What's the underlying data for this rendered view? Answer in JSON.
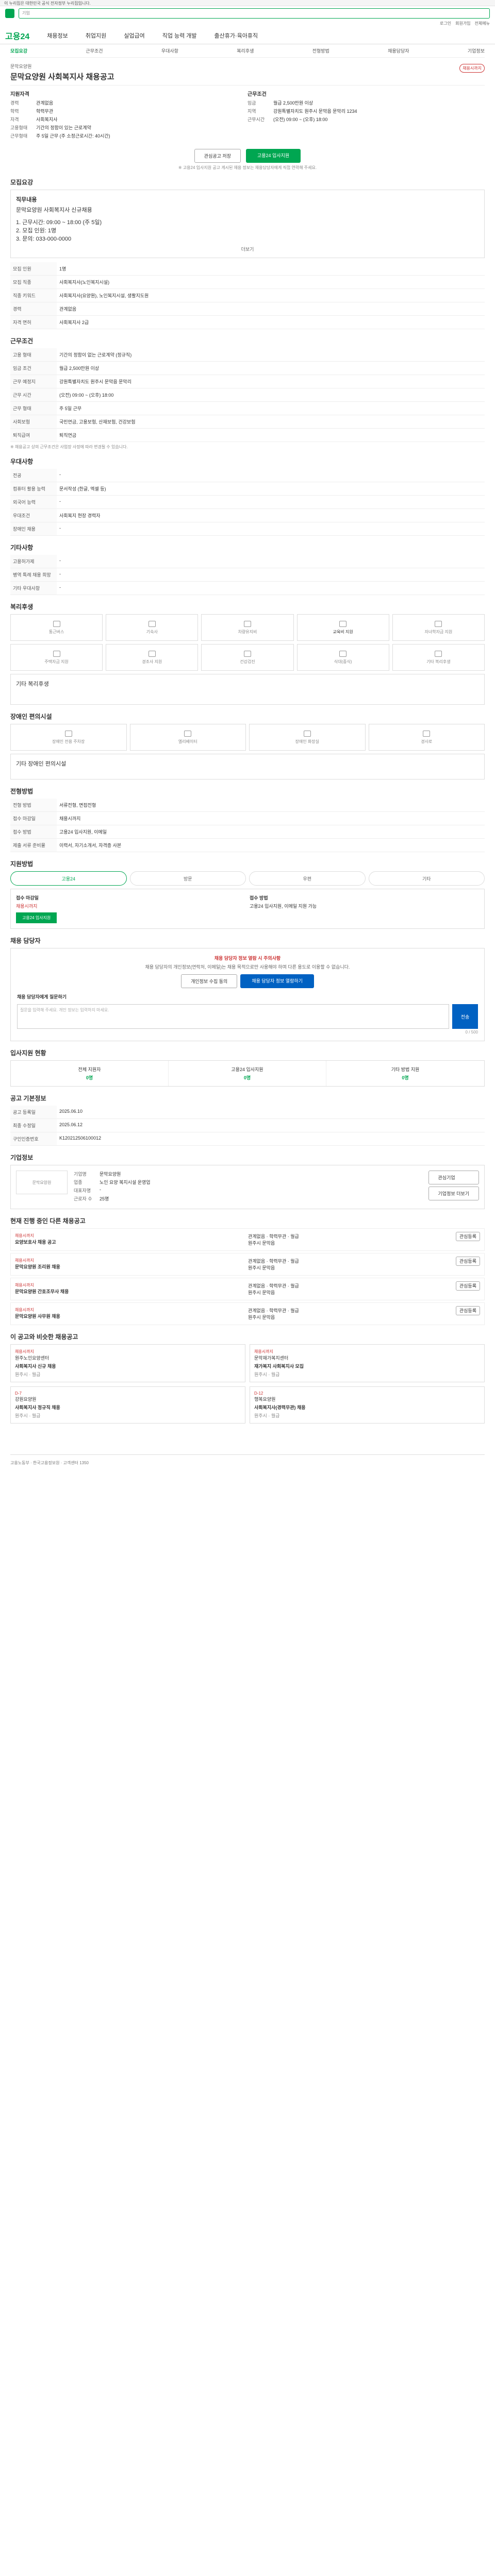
{
  "gov_banner": "이 누리집은 대한민국 공식 전자정부 누리집입니다.",
  "header": {
    "search_placeholder": "기업",
    "top_links": [
      "로그인",
      "회원가입",
      "전체메뉴"
    ],
    "brand": "고용24",
    "menus": [
      "채용정보",
      "취업지원",
      "실업급여",
      "직업 능력 개발",
      "출산휴가·육아휴직"
    ]
  },
  "detail_tabs": [
    "모집요강",
    "근무조건",
    "우대사항",
    "복리후생",
    "전형방법",
    "채용담당자",
    "기업정보"
  ],
  "job": {
    "company": "문막요양원",
    "title": "문막요양원 사회복지사 채용공고",
    "badge": "채용시까지",
    "summary_left": {
      "heading": "지원자격",
      "rows": [
        {
          "k": "경력",
          "v": "관계없음"
        },
        {
          "k": "학력",
          "v": "학력무관"
        },
        {
          "k": "자격",
          "v": "사회복지사"
        },
        {
          "k": "고용형태",
          "v": "기간의 정함이 있는 근로계약"
        },
        {
          "k": "근무형태",
          "v": "주 5일 근무 (주 소정근로시간: 40시간)"
        }
      ]
    },
    "summary_right": {
      "heading": "근무조건",
      "rows": [
        {
          "k": "임금",
          "v": "월급 2,500만원 이상"
        },
        {
          "k": "지역",
          "v": "강원특별자치도 원주시 문막읍 문막리 1234"
        },
        {
          "k": "근무시간",
          "v": "(오전) 09:00 ~ (오후) 18:00"
        }
      ]
    },
    "save_btn": "관심공고 저장",
    "apply_btn": "고용24 입사지원",
    "notice": "※ 고용24 입사지원 공고 게시된 채용 정보는 채용담당자에게 직접 연락해 주세요."
  },
  "recruit": {
    "heading": "모집요강",
    "duties_title": "직무내용",
    "duties": [
      "문막요양원 사회복지사 신규채용",
      "1. 근무시간: 09:00 ~ 18:00 (주 5일)",
      "2. 모집 인원: 1명",
      "3. 문의: 033-000-0000"
    ],
    "more": "더보기",
    "rows": [
      {
        "k": "모집 인원",
        "v": "1명"
      },
      {
        "k": "모집 직종",
        "v": "사회복지사(노인복지시설)"
      },
      {
        "k": "직종 키워드",
        "v": "사회복지사(요양원), 노인복지시설, 생활지도원"
      },
      {
        "k": "경력",
        "v": "관계없음"
      },
      {
        "k": "자격 면허",
        "v": "사회복지사 2급"
      }
    ]
  },
  "conditions": {
    "heading": "근무조건",
    "rows": [
      {
        "k": "고용 형태",
        "v": "기간의 정함이 없는 근로계약 (정규직)"
      },
      {
        "k": "임금 조건",
        "v": "월급 2,500만원 이상"
      },
      {
        "k": "근무 예정지",
        "v": "강원특별자치도 원주시 문막읍 문막리"
      },
      {
        "k": "근무 시간",
        "v": "(오전) 09:00 ~ (오후) 18:00"
      },
      {
        "k": "근무 형태",
        "v": "주 5일 근무"
      },
      {
        "k": "사회보험",
        "v": "국민연금, 고용보험, 산재보험, 건강보험"
      },
      {
        "k": "퇴직급여",
        "v": "퇴직연금"
      }
    ],
    "note": "※ 채용공고 상의 근무조건은 사업장 사정에 따라 변경될 수 있습니다."
  },
  "preference": {
    "heading": "우대사항",
    "rows": [
      {
        "k": "전공",
        "v": "-"
      },
      {
        "k": "컴퓨터 활용 능력",
        "v": "문서작성 (한글, 엑셀 등)"
      },
      {
        "k": "외국어 능력",
        "v": "-"
      },
      {
        "k": "우대조건",
        "v": "사회복지 현장 경력자"
      },
      {
        "k": "장애인 채용",
        "v": "-"
      }
    ]
  },
  "other": {
    "heading": "기타사항",
    "rows": [
      {
        "k": "고용허가제",
        "v": "-"
      },
      {
        "k": "병역 특례 채용 희망",
        "v": "-"
      },
      {
        "k": "기타 우대사항",
        "v": "-"
      }
    ]
  },
  "welfare": {
    "heading": "복리후생",
    "icons": [
      "통근버스",
      "기숙사",
      "차량유지비",
      "교육비 지원",
      "자녀학자금 지원",
      "주택자금 지원",
      "경조사 지원",
      "건강검진",
      "식대(중식)",
      "기타 복리후생"
    ],
    "active_index": 3,
    "note": "기타 복리후생"
  },
  "disability": {
    "heading": "장애인 편의시설",
    "icons": [
      "장애인 전용 주차장",
      "엘리베이터",
      "장애인 화장실",
      "경사로"
    ],
    "note": "기타 장애인 편의시설"
  },
  "screening": {
    "heading": "전형방법",
    "rows": [
      {
        "k": "전형 방법",
        "v": "서류전형, 면접전형"
      },
      {
        "k": "접수 마감일",
        "v": "채용시까지"
      },
      {
        "k": "접수 방법",
        "v": "고용24 입사지원, 이메일"
      },
      {
        "k": "제출 서류 준비물",
        "v": "이력서, 자기소개서, 자격증 사본"
      }
    ]
  },
  "apply_method": {
    "heading": "지원방법",
    "methods": [
      "고용24",
      "방문",
      "우편",
      "기타"
    ],
    "left_title": "접수 마감일",
    "left_text": "채용시까지",
    "left_btn": "고용24 입사지원",
    "right_title": "접수 방법",
    "right_text": "고용24 입사지원, 이메일 지원 가능"
  },
  "manager": {
    "heading": "채용 담당자",
    "warn": "채용 담당자 정보 열람 시 주의사항",
    "text": "채용 담당자의 개인정보(연락처, 이메일)는 채용 목적으로만 사용해야 하며 다른 용도로 이용할 수 없습니다.",
    "btn1": "개인정보 수집 동의",
    "btn2": "채용 담당자 정보 열람하기",
    "q_label": "채용 담당자에게 질문하기",
    "q_placeholder": "질문을 입력해 주세요. 개인 정보는 입력하지 마세요.",
    "q_send": "전송",
    "counter": "0 / 500"
  },
  "applicants": {
    "heading": "입사지원 현황",
    "stats": [
      {
        "label": "전체 지원자",
        "value": "0명"
      },
      {
        "label": "고용24 입사지원",
        "value": "0명"
      },
      {
        "label": "기타 방법 지원",
        "value": "0명"
      }
    ]
  },
  "posting": {
    "heading": "공고 기본정보",
    "rows": [
      {
        "k": "공고 등록일",
        "v": "2025.06.10"
      },
      {
        "k": "최종 수정일",
        "v": "2025.06.12"
      },
      {
        "k": "구인인증번호",
        "v": "K120212506100012"
      }
    ]
  },
  "company": {
    "heading": "기업정보",
    "logo": "문막요양원",
    "rows": [
      {
        "k": "기업명",
        "v": "문막요양원"
      },
      {
        "k": "업종",
        "v": "노인 요양 복지시설 운영업"
      },
      {
        "k": "대표자명",
        "v": "-"
      },
      {
        "k": "근로자 수",
        "v": "25명"
      }
    ],
    "btn_follow": "관심기업",
    "btn_more": "기업정보 더보기"
  },
  "related": {
    "heading": "현재 진행 중인 다른 채용공고",
    "items": [
      {
        "status": "채용시까지",
        "title": "요양보호사 채용 공고",
        "cond": "관계없음 · 학력무관 · 월급",
        "place": "원주시 문막읍"
      },
      {
        "status": "채용시까지",
        "title": "문막요양원 조리원 채용",
        "cond": "관계없음 · 학력무관 · 월급",
        "place": "원주시 문막읍"
      },
      {
        "status": "채용시까지",
        "title": "문막요양원 간호조무사 채용",
        "cond": "관계없음 · 학력무관 · 월급",
        "place": "원주시 문막읍"
      },
      {
        "status": "채용시까지",
        "title": "문막요양원 사무원 채용",
        "cond": "관계없음 · 학력무관 · 월급",
        "place": "원주시 문막읍"
      }
    ],
    "btn": "관심등록"
  },
  "recommend": {
    "heading": "이 공고와 비슷한 채용공고",
    "items": [
      {
        "dday": "채용시까지",
        "company": "원주노인요양센터",
        "title": "사회복지사 신규 채용",
        "meta": "원주시 · 월급"
      },
      {
        "dday": "채용시까지",
        "company": "문막재가복지센터",
        "title": "재가복지 사회복지사 모집",
        "meta": "원주시 · 월급"
      },
      {
        "dday": "D-7",
        "company": "강원요양원",
        "title": "사회복지사 정규직 채용",
        "meta": "원주시 · 월급"
      },
      {
        "dday": "D-12",
        "company": "행복요양원",
        "title": "사회복지사(경력무관) 채용",
        "meta": "원주시 · 월급"
      }
    ]
  },
  "footer": "고용노동부 · 한국고용정보원 · 고객센터 1350"
}
